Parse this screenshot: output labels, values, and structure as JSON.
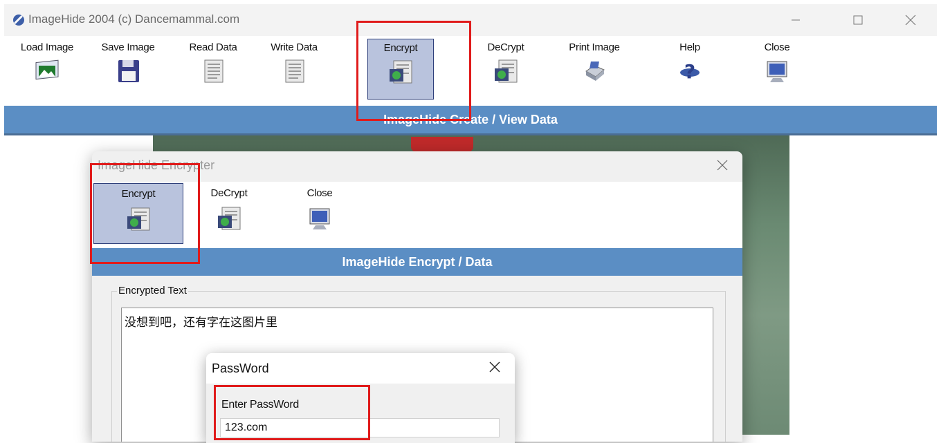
{
  "main_window": {
    "title": "ImageHide 2004 (c) Dancemammal.com",
    "toolbar": [
      {
        "label": "Load Image",
        "icon": "load-image-icon"
      },
      {
        "label": "Save Image",
        "icon": "floppy-disk-icon"
      },
      {
        "label": "Read Data",
        "icon": "data-file-icon"
      },
      {
        "label": "Write Data",
        "icon": "data-file-icon"
      },
      {
        "label": "Encrypt",
        "icon": "encrypt-icon",
        "active": true
      },
      {
        "label": "DeCrypt",
        "icon": "decrypt-icon"
      },
      {
        "label": "Print Image",
        "icon": "printer-icon"
      },
      {
        "label": "Help",
        "icon": "help-icon"
      },
      {
        "label": "Close",
        "icon": "monitor-icon"
      }
    ],
    "banner": "ImageHide Create / View Data"
  },
  "encrypter_dialog": {
    "title": "ImageHide Encrypter",
    "toolbar": [
      {
        "label": "Encrypt",
        "icon": "encrypt-icon",
        "active": true
      },
      {
        "label": "DeCrypt",
        "icon": "decrypt-icon"
      },
      {
        "label": "Close",
        "icon": "monitor-icon"
      }
    ],
    "banner": "ImageHide Encrypt / Data",
    "group_label": "Encrypted Text",
    "text": "没想到吧，还有字在这图片里"
  },
  "password_dialog": {
    "title": "PassWord",
    "label": "Enter PassWord",
    "value": "123.com"
  },
  "colors": {
    "banner": "#5b8ec4",
    "active_button": "#b9c3dd",
    "highlight": "#e01b1b"
  }
}
